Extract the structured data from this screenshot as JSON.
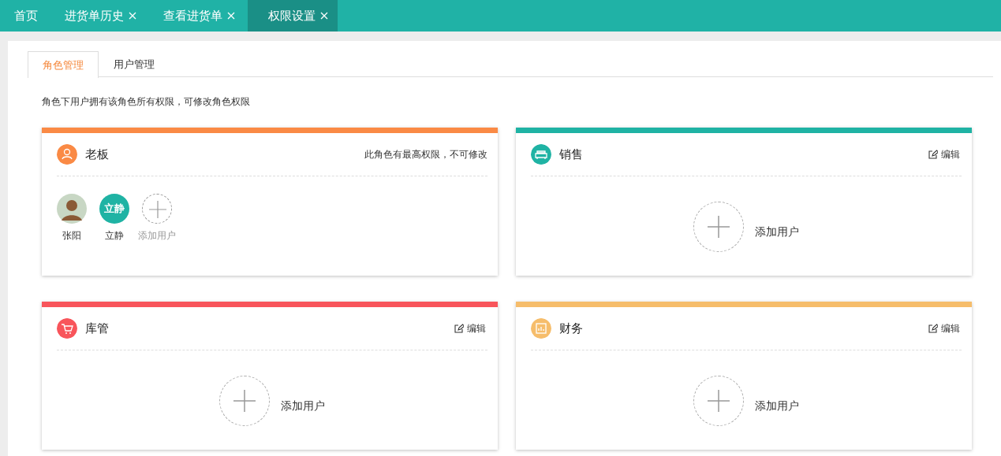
{
  "top_tabs": [
    {
      "label": "首页",
      "closable": false,
      "selected": false
    },
    {
      "label": "进货单历史",
      "closable": true,
      "selected": false
    },
    {
      "label": "查看进货单",
      "closable": true,
      "selected": false
    },
    {
      "label": "权限设置",
      "closable": true,
      "selected": true
    }
  ],
  "sub_tabs": [
    {
      "label": "角色管理",
      "selected": true
    },
    {
      "label": "用户管理",
      "selected": false
    }
  ],
  "description": "角色下用户拥有该角色所有权限，可修改角色权限",
  "roles": [
    {
      "title": "老板",
      "color": "#fa8a45",
      "note": "此角色有最高权限，不可修改",
      "users": [
        {
          "kind": "photo",
          "name": "张阳"
        },
        {
          "kind": "initials",
          "initials": "立静",
          "name": "立静"
        }
      ],
      "add_label": "添加用户"
    },
    {
      "title": "销售",
      "color": "#1fb3a4",
      "edit_label": "编辑",
      "add_label": "添加用户"
    },
    {
      "title": "库管",
      "color": "#f8555b",
      "edit_label": "编辑",
      "add_label": "添加用户"
    },
    {
      "title": "财务",
      "color": "#f6bd6b",
      "edit_label": "编辑",
      "add_label": "添加用户"
    }
  ]
}
